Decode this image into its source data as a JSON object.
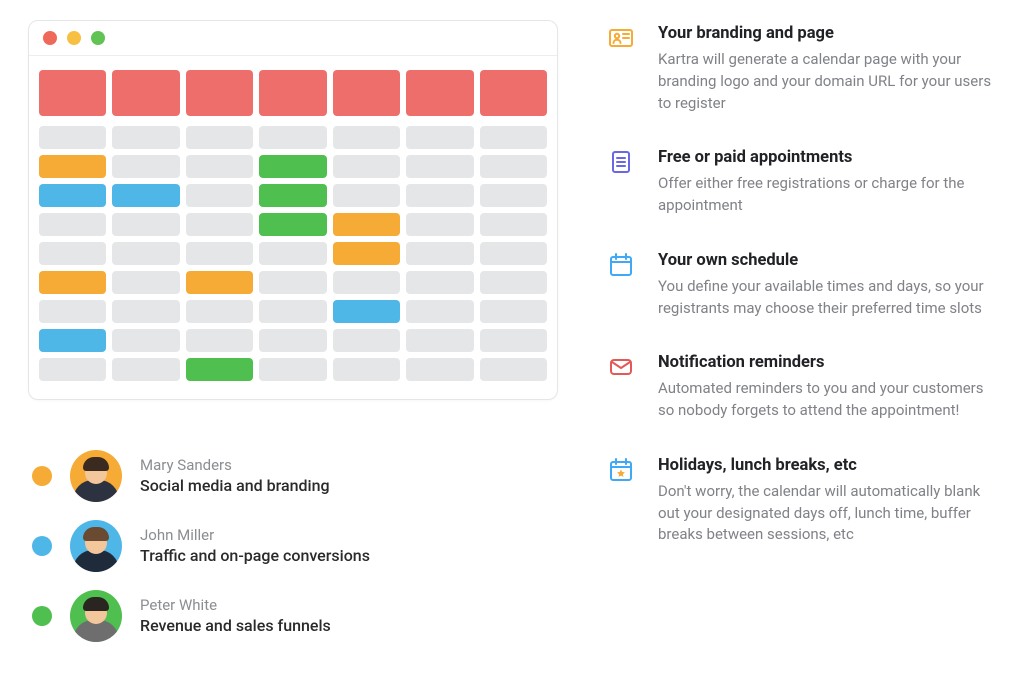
{
  "colors": {
    "orange": "#f5ab35",
    "blue": "#4fb6e8",
    "green": "#4fbf4f",
    "red": "#ee6e6b",
    "gray_cell": "#e4e6e8",
    "feat_yellow": "#f5ab35",
    "feat_purple": "#6a67e6",
    "feat_blue": "#3fa9f5",
    "feat_red": "#e45858"
  },
  "calendar": {
    "columns": 7,
    "rows": [
      [
        "",
        "",
        "",
        "",
        "",
        "",
        ""
      ],
      [
        "orange",
        "",
        "",
        "green",
        "",
        "",
        ""
      ],
      [
        "blue",
        "blue",
        "",
        "green",
        "",
        "",
        ""
      ],
      [
        "",
        "",
        "",
        "green",
        "orange",
        "",
        ""
      ],
      [
        "",
        "",
        "",
        "",
        "orange",
        "",
        ""
      ],
      [
        "orange",
        "",
        "orange",
        "",
        "",
        "",
        ""
      ],
      [
        "",
        "",
        "",
        "",
        "blue",
        "",
        ""
      ],
      [
        "blue",
        "",
        "",
        "",
        "",
        "",
        ""
      ],
      [
        "",
        "",
        "green",
        "",
        "",
        "",
        ""
      ]
    ]
  },
  "people": [
    {
      "swatch": "orange",
      "name": "Mary Sanders",
      "role": "Social media and branding",
      "avatar_bg": "#f5ab35",
      "avatar_body": "#2d3240",
      "avatar_hair": "#3b2a1f"
    },
    {
      "swatch": "blue",
      "name": "John Miller",
      "role": "Traffic and on-page conversions",
      "avatar_bg": "#4fb6e8",
      "avatar_body": "#1f2a3a",
      "avatar_hair": "#6b4a32"
    },
    {
      "swatch": "green",
      "name": "Peter White",
      "role": "Revenue and sales funnels",
      "avatar_bg": "#4fbf4f",
      "avatar_body": "#6e6e6e",
      "avatar_hair": "#2a2520"
    }
  ],
  "features": [
    {
      "icon": "id-card-icon",
      "color": "#f5ab35",
      "title": "Your branding and page",
      "desc": "Kartra will generate a calendar page with your branding logo and your domain URL for your users to register"
    },
    {
      "icon": "document-lines-icon",
      "color": "#6a67e6",
      "title": "Free or paid appointments",
      "desc": "Offer either free registrations or charge for the appointment"
    },
    {
      "icon": "calendar-icon",
      "color": "#3fa9f5",
      "title": "Your own schedule",
      "desc": "You define your available times and days, so your registrants may choose their preferred time slots"
    },
    {
      "icon": "mail-icon",
      "color": "#e45858",
      "title": "Notification reminders",
      "desc": "Automated reminders to you and your customers so nobody forgets to attend the appointment!"
    },
    {
      "icon": "calendar-star-icon",
      "color": "#3fa9f5",
      "title": "Holidays, lunch breaks, etc",
      "desc": "Don't worry, the calendar will automatically blank out your designated days off, lunch time, buffer breaks between sessions, etc"
    }
  ]
}
